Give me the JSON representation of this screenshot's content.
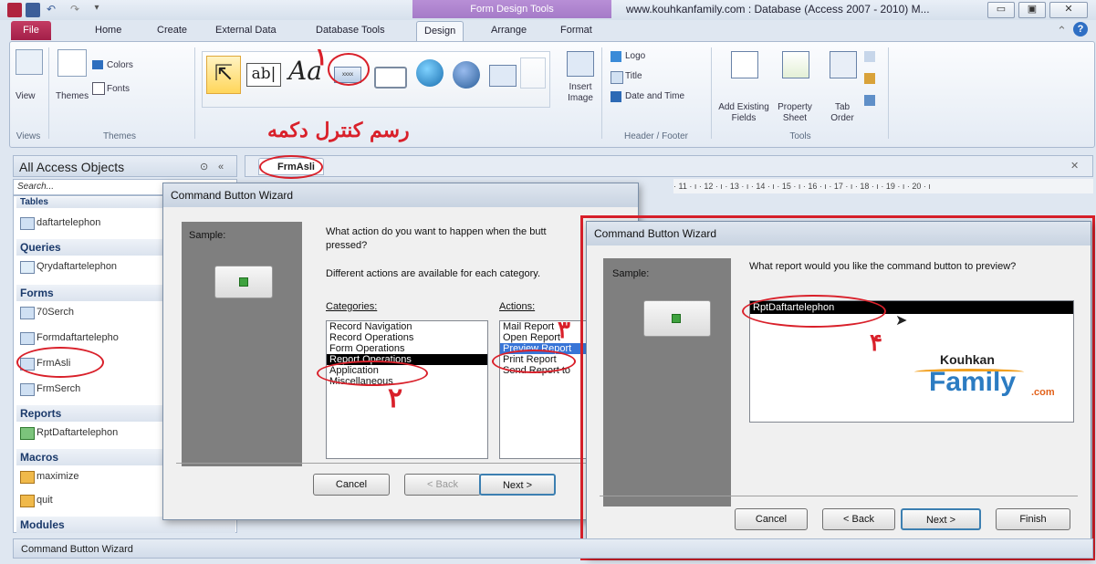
{
  "window": {
    "context_tab_title": "Form Design Tools",
    "title": "www.kouhkanfamily.com : Database (Access 2007 - 2010) M...",
    "controls": [
      "▭",
      "▣",
      "✕"
    ]
  },
  "ribbon_tabs": [
    "File",
    "Home",
    "Create",
    "External Data",
    "Database Tools",
    "Design",
    "Arrange",
    "Format"
  ],
  "ribbon": {
    "views_label": "View",
    "views_group": "Views",
    "themes_label": "Themes",
    "colors_label": "Colors",
    "fonts_label": "Fonts",
    "themes_group": "Themes",
    "insert_image": "Insert Image",
    "logo": "Logo",
    "title": "Title",
    "date_time": "Date and Time",
    "header_footer_group": "Header / Footer",
    "add_existing_fields": "Add Existing Fields",
    "property_sheet": "Property Sheet",
    "tab_order": "Tab Order",
    "tools_group": "Tools",
    "annotation_text": "رسم کنترل دکمه",
    "annotation_num": "۱"
  },
  "nav": {
    "header": "All Access Objects",
    "search_placeholder": "Search...",
    "groups": {
      "tables": "Tables",
      "queries": "Queries",
      "forms": "Forms",
      "reports": "Reports",
      "macros": "Macros",
      "modules": "Modules"
    },
    "tables": [
      "daftartelephon"
    ],
    "queries": [
      "Qrydaftartelephon"
    ],
    "forms": [
      "70Serch",
      "Formdaftartelepho",
      "FrmAsli",
      "FrmSerch"
    ],
    "reports": [
      "RptDaftartelephon"
    ],
    "macros": [
      "maximize",
      "quit"
    ]
  },
  "doc_tab": "FrmAsli",
  "ruler": "· 11 · ı · 12 · ı · 13 · ı · 14 · ı · 15 · ı · 16 · ı · 17 · ı · 18 · ı · 19 · ı · 20 · ı",
  "status": "Command Button Wizard",
  "dialog1": {
    "title": "Command Button Wizard",
    "sample_label": "Sample:",
    "question": "What action do you want to happen when the butt pressed?",
    "question_line1": "What action do you want to happen when the butt",
    "question_line2": "pressed?",
    "info": "Different actions are available for each category.",
    "categories_label": "Categories:",
    "actions_label": "Actions:",
    "categories": [
      "Record Navigation",
      "Record Operations",
      "Form Operations",
      "Report Operations",
      "Application",
      "Miscellaneous"
    ],
    "actions": [
      "Mail Report",
      "Open Report",
      "Preview Report",
      "Print Report",
      "Send Report to"
    ],
    "cancel": "Cancel",
    "back": "< Back",
    "next": "Next >",
    "num2": "۲",
    "num3": "۳"
  },
  "dialog2": {
    "title": "Command Button Wizard",
    "sample_label": "Sample:",
    "question": "What report would you like the command button to preview?",
    "reports": [
      "RptDaftartelephon"
    ],
    "cancel": "Cancel",
    "back": "< Back",
    "next": "Next >",
    "finish": "Finish",
    "num4": "۴",
    "logo_top": "Kouhkan",
    "logo_main": "Family",
    "logo_suffix": ".com"
  }
}
